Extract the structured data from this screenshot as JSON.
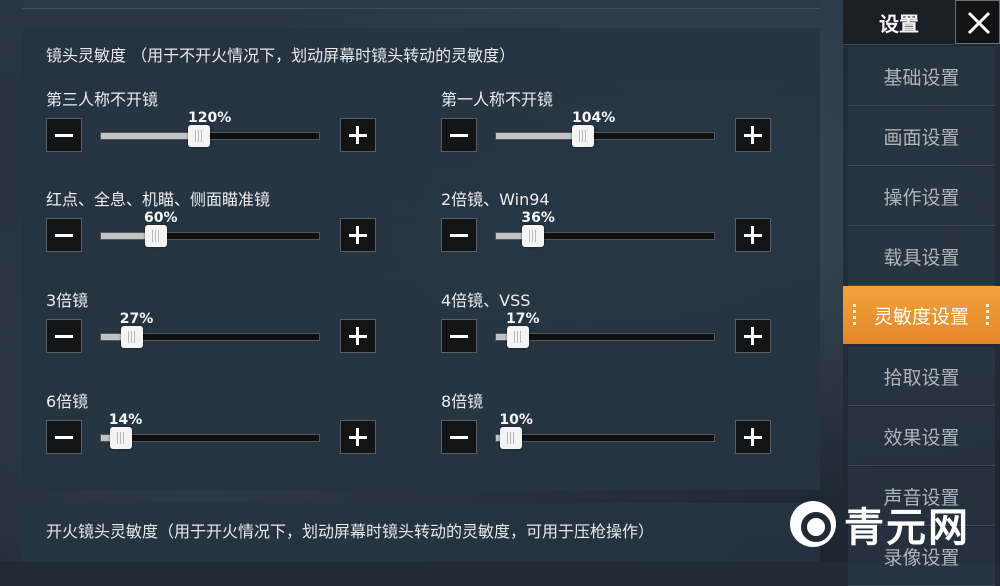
{
  "header": {
    "title": "设置",
    "close_icon": "close-icon"
  },
  "sidebar": {
    "items": [
      {
        "label": "基础设置",
        "active": false
      },
      {
        "label": "画面设置",
        "active": false
      },
      {
        "label": "操作设置",
        "active": false
      },
      {
        "label": "载具设置",
        "active": false
      },
      {
        "label": "灵敏度设置",
        "active": true
      },
      {
        "label": "拾取设置",
        "active": false
      },
      {
        "label": "效果设置",
        "active": false
      },
      {
        "label": "声音设置",
        "active": false
      },
      {
        "label": "录像设置",
        "active": false
      }
    ]
  },
  "main": {
    "section_title": "镜头灵敏度  （用于不开火情况下，划动屏幕时镜头转动的灵敏度）",
    "sliders": [
      {
        "label": "第三人称不开镜",
        "value_text": "120%",
        "level": 0.4
      },
      {
        "label": "第一人称不开镜",
        "value_text": "104%",
        "level": 0.35
      },
      {
        "label": "红点、全息、机瞄、侧面瞄准镜",
        "value_text": "60%",
        "level": 0.2
      },
      {
        "label": "2倍镜、Win94",
        "value_text": "36%",
        "level": 0.12
      },
      {
        "label": "3倍镜",
        "value_text": "27%",
        "level": 0.09
      },
      {
        "label": "4倍镜、VSS",
        "value_text": "17%",
        "level": 0.05
      },
      {
        "label": "6倍镜",
        "value_text": "14%",
        "level": 0.04
      },
      {
        "label": "8倍镜",
        "value_text": "10%",
        "level": 0.02
      }
    ],
    "section2_title": "开火镜头灵敏度（用于开火情况下，划动屏幕时镜头转动的灵敏度，可用于压枪操作）"
  },
  "watermark": {
    "text": "青元网"
  },
  "colors": {
    "accent": "#ec9533",
    "panel": "#263442",
    "button": "#121416"
  }
}
